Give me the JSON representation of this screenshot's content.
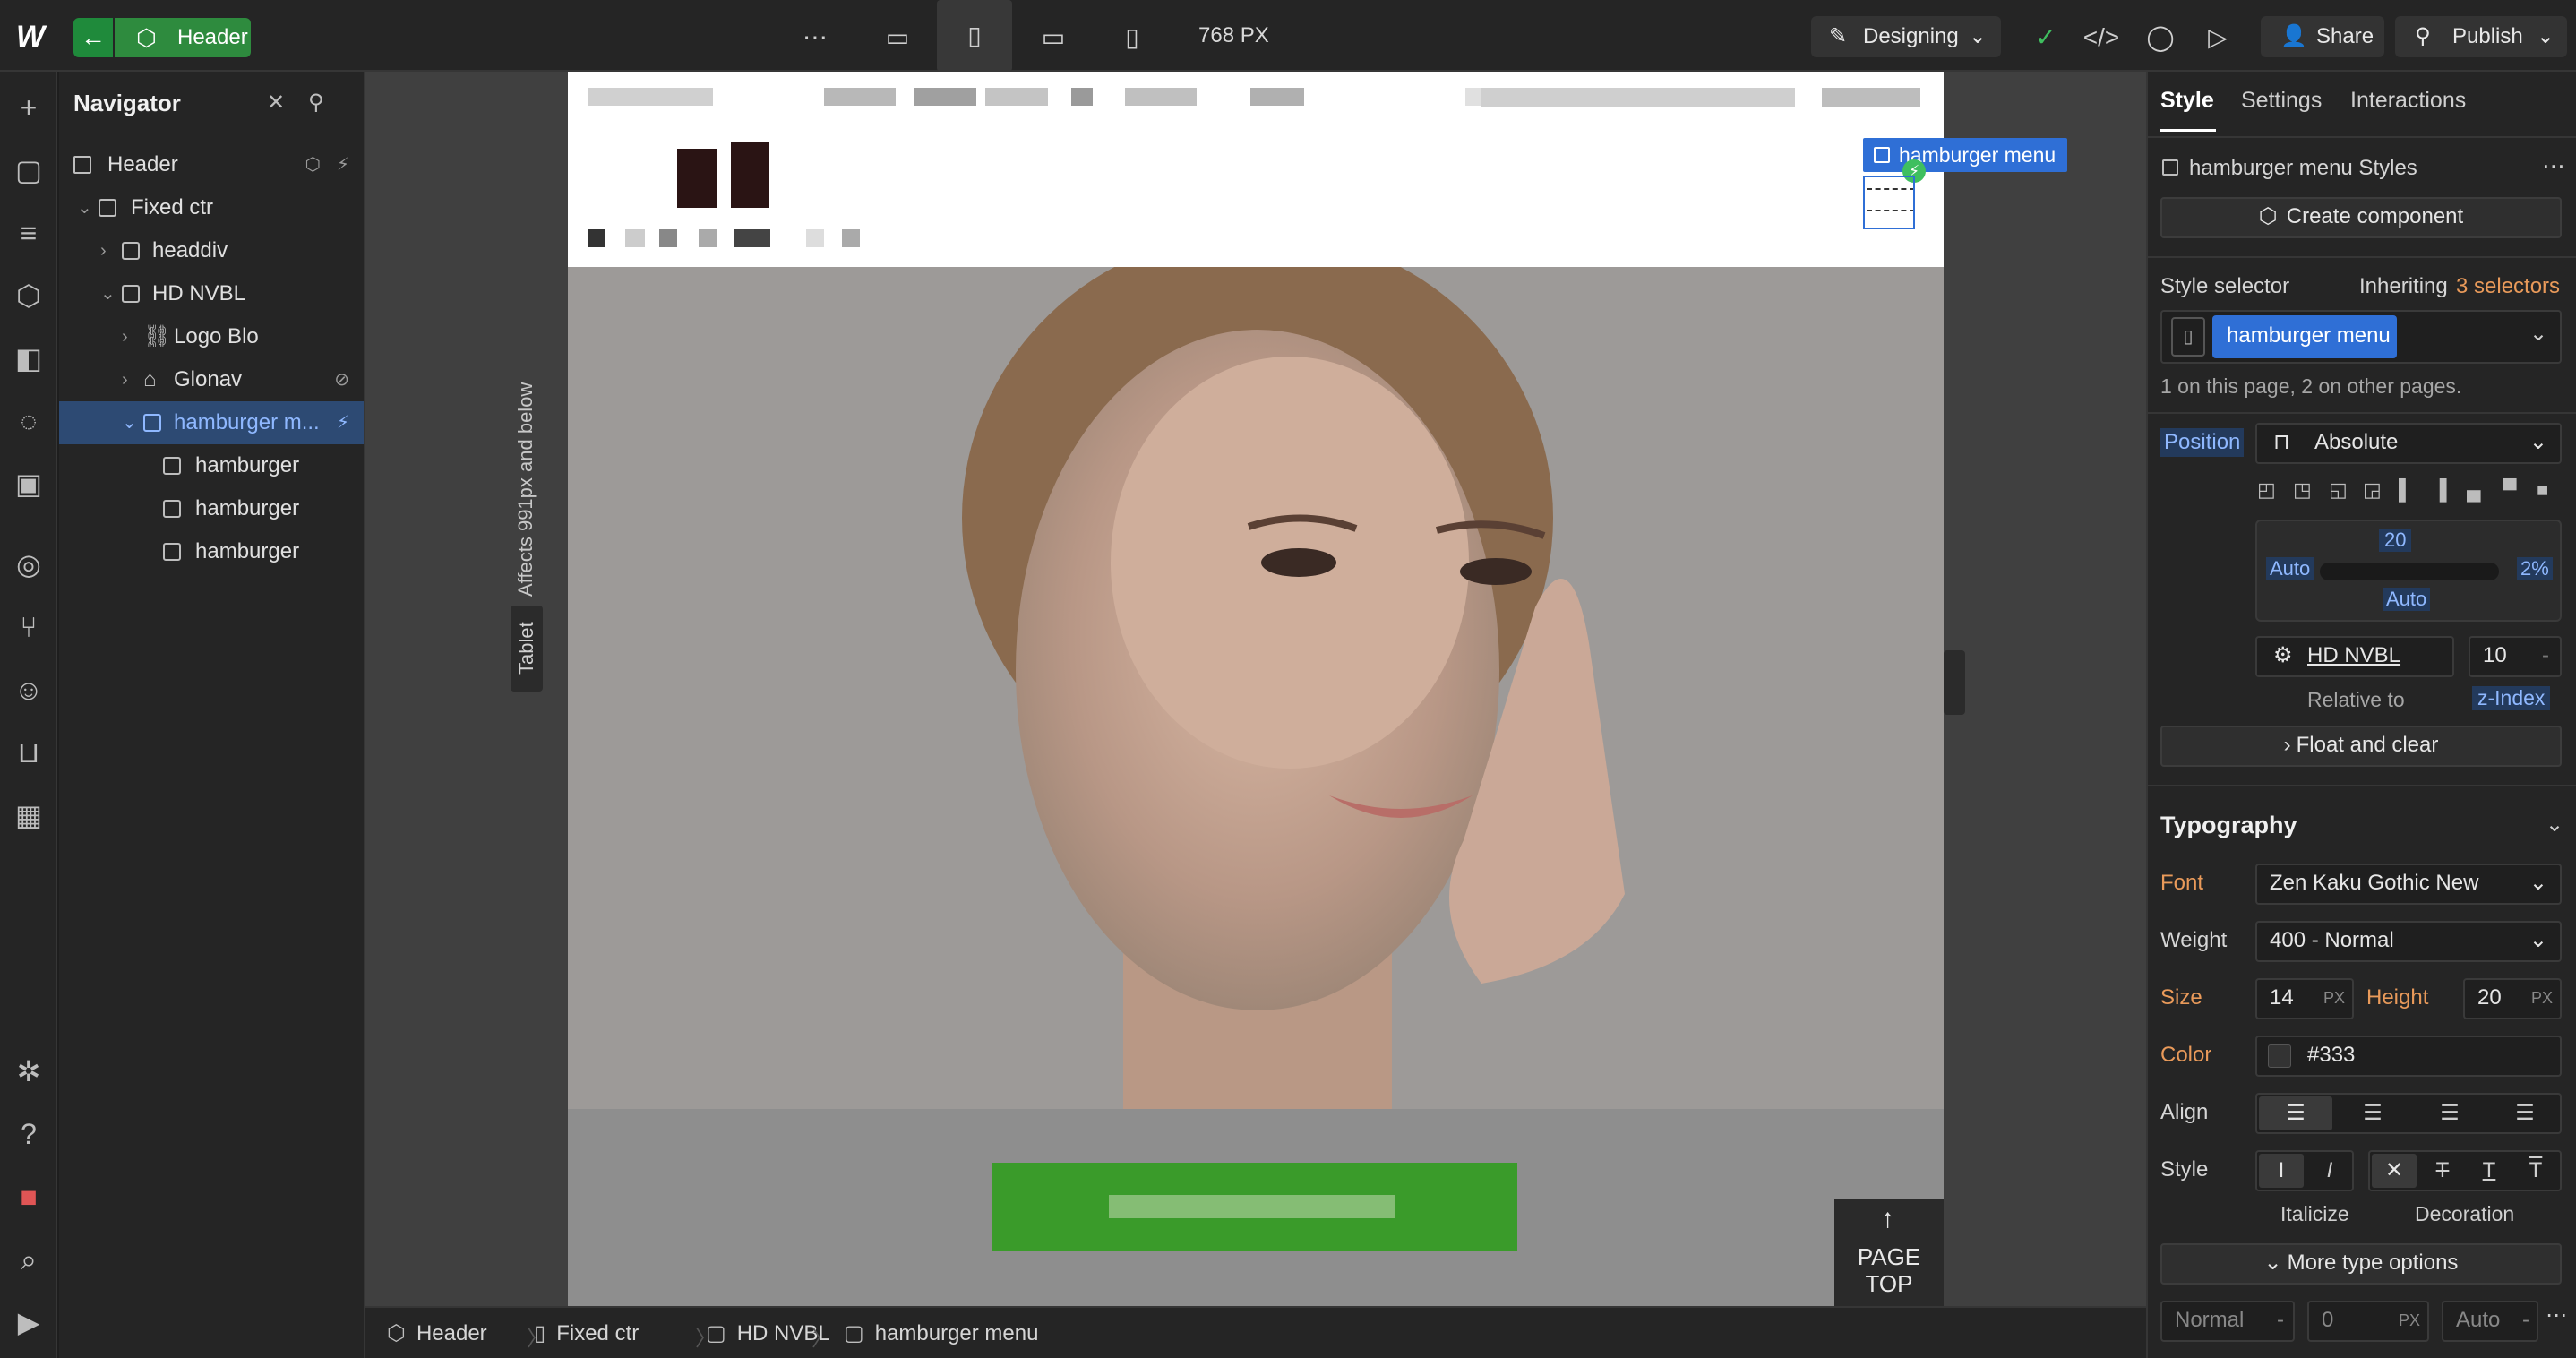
{
  "topbar": {
    "component_label": "Header",
    "width_readout": "768 PX",
    "mode_label": "Designing",
    "share_label": "Share",
    "publish_label": "Publish"
  },
  "navigator": {
    "title": "Navigator",
    "items": [
      {
        "label": "Header"
      },
      {
        "label": "Fixed ctr"
      },
      {
        "label": "headdiv"
      },
      {
        "label": "HD NVBL"
      },
      {
        "label": "Logo Blo"
      },
      {
        "label": "Glonav"
      },
      {
        "label": "hamburger m..."
      },
      {
        "label": "hamburger"
      },
      {
        "label": "hamburger"
      },
      {
        "label": "hamburger"
      }
    ]
  },
  "canvas": {
    "selected_tag": "hamburger menu",
    "breakpoint_tag": "Tablet",
    "breakpoint_note": "Affects 991px and below",
    "page_top_line1": "PAGE",
    "page_top_line2": "TOP"
  },
  "breadcrumbs": [
    "Header",
    "Fixed ctr",
    "HD NVBL",
    "hamburger menu"
  ],
  "panel": {
    "tabs": [
      "Style",
      "Settings",
      "Interactions"
    ],
    "styles_title": "hamburger menu Styles",
    "create_component": "Create component",
    "style_selector_label": "Style selector",
    "inheriting_prefix": "Inheriting",
    "inheriting_count": "3 selectors",
    "selector_chip": "hamburger menu",
    "usage_note": "1 on this page, 2 on other pages.",
    "position_label": "Position",
    "position_value": "Absolute",
    "pos_top": "20",
    "pos_left": "Auto",
    "pos_right": "2%",
    "pos_bottom": "Auto",
    "relative_to_value": "HD NVBL",
    "relative_to_label": "Relative to",
    "z_index_value": "10",
    "z_index_label": "z-Index",
    "float_clear": "Float and clear",
    "typography_title": "Typography",
    "font_label": "Font",
    "font_value": "Zen Kaku Gothic New",
    "weight_label": "Weight",
    "weight_value": "400 - Normal",
    "size_label": "Size",
    "size_value": "14",
    "size_unit": "PX",
    "height_label": "Height",
    "height_value": "20",
    "height_unit": "PX",
    "color_label": "Color",
    "color_value": "#333",
    "align_label": "Align",
    "style_label": "Style",
    "italicize_label": "Italicize",
    "decoration_label": "Decoration",
    "more_type": "More type options",
    "bottom_field1": "Normal",
    "bottom_field2": "0",
    "bottom_field2_unit": "PX",
    "bottom_field3": "Auto"
  },
  "colors": {
    "accent_blue": "#2f6fd6",
    "component_green": "#2e8b3e",
    "label_orange": "#e99a5a"
  }
}
